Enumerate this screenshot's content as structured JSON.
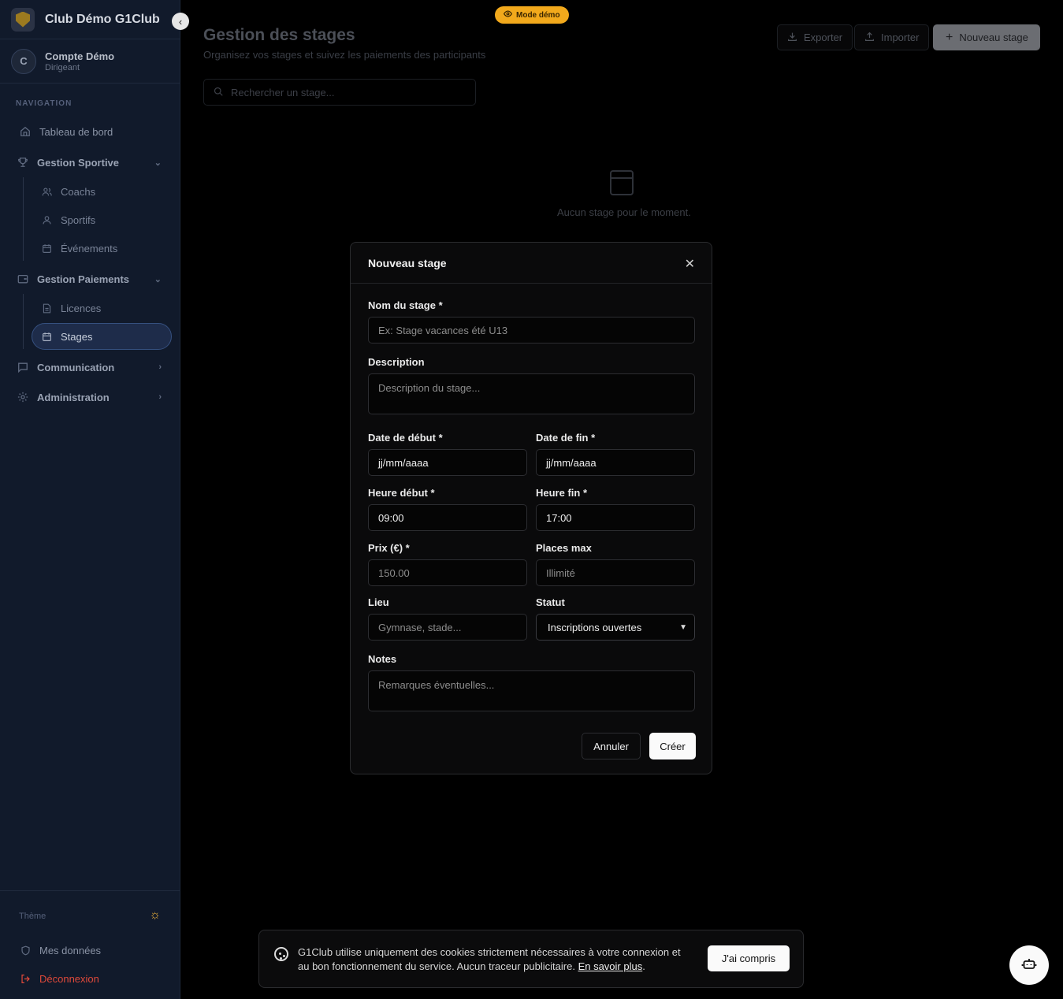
{
  "sidebar": {
    "brand": "Club Démo G1Club",
    "account": {
      "initial": "C",
      "name": "Compte Démo",
      "role": "Dirigeant"
    },
    "nav_header": "NAVIGATION",
    "items": {
      "dashboard": "Tableau de bord",
      "sport_group": "Gestion Sportive",
      "coachs": "Coachs",
      "sportifs": "Sportifs",
      "evenements": "Événements",
      "payments_group": "Gestion Paiements",
      "licences": "Licences",
      "stages": "Stages",
      "communication": "Communication",
      "administration": "Administration"
    },
    "theme_label": "Thème",
    "my_data": "Mes données",
    "logout": "Déconnexion"
  },
  "demo_badge": "Mode démo",
  "header": {
    "title": "Gestion des stages",
    "subtitle": "Organisez vos stages et suivez les paiements des participants",
    "export": "Exporter",
    "import": "Importer",
    "new_stage": "Nouveau stage"
  },
  "search": {
    "placeholder": "Rechercher un stage..."
  },
  "empty_state": "Aucun stage pour le moment.",
  "modal": {
    "title": "Nouveau stage",
    "name_label": "Nom du stage *",
    "name_placeholder": "Ex: Stage vacances été U13",
    "desc_label": "Description",
    "desc_placeholder": "Description du stage...",
    "start_date_label": "Date de début *",
    "start_date_value": "jj/mm/aaaa",
    "end_date_label": "Date de fin *",
    "end_date_value": "jj/mm/aaaa",
    "start_time_label": "Heure début *",
    "start_time_value": "09:00",
    "end_time_label": "Heure fin *",
    "end_time_value": "17:00",
    "price_label": "Prix (€) *",
    "price_value": "150.00",
    "places_label": "Places max",
    "places_placeholder": "Illimité",
    "location_label": "Lieu",
    "location_placeholder": "Gymnase, stade...",
    "status_label": "Statut",
    "status_value": "Inscriptions ouvertes",
    "notes_label": "Notes",
    "notes_placeholder": "Remarques éventuelles...",
    "cancel": "Annuler",
    "create": "Créer"
  },
  "cookie": {
    "text": "G1Club utilise uniquement des cookies strictement nécessaires à votre connexion et au bon fonctionnement du service. Aucun traceur publicitaire.",
    "link": "En savoir plus",
    "period": ".",
    "button": "J'ai compris"
  },
  "colors": {
    "accent_demo": "#f2a91c",
    "sidebar_bg": "#111a2b",
    "logout": "#e0493a"
  }
}
